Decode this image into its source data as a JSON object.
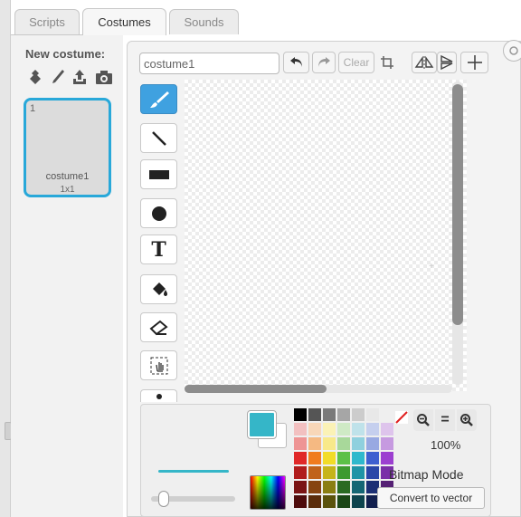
{
  "tabs": [
    {
      "label": "Scripts",
      "active": false
    },
    {
      "label": "Costumes",
      "active": true
    },
    {
      "label": "Sounds",
      "active": false
    }
  ],
  "sidebar": {
    "new_costume_label": "New costume:",
    "new_costume_icons": [
      "sprite-library-icon",
      "paint-brush-icon",
      "upload-icon",
      "camera-icon"
    ],
    "costume": {
      "index": "1",
      "name": "costume1",
      "size": "1x1"
    }
  },
  "editor": {
    "costume_name_value": "costume1",
    "toolbar": {
      "undo_icon": "undo-icon",
      "redo_icon": "redo-icon",
      "clear_label": "Clear",
      "crop_icon": "crop-icon",
      "flip_h_icon": "flip-horizontal-icon",
      "flip_v_icon": "flip-vertical-icon",
      "center_icon": "set-center-icon"
    },
    "tools": [
      {
        "name": "brush",
        "selected": true
      },
      {
        "name": "line"
      },
      {
        "name": "rectangle"
      },
      {
        "name": "ellipse"
      },
      {
        "name": "text",
        "label": "T"
      },
      {
        "name": "fill"
      },
      {
        "name": "eraser"
      },
      {
        "name": "select"
      },
      {
        "name": "stamp"
      }
    ],
    "colors": {
      "primary": "#35b6c8",
      "secondary": "#ffffff",
      "selected_tool": "#3fa1e0"
    },
    "palette": [
      [
        "#000000",
        "#555555",
        "#7a7a7a",
        "#a6a6a6",
        "#cccccc",
        "#e8e8e8",
        "#ffffff"
      ],
      [
        "#f2c0c0",
        "#f8d7b8",
        "#fbf2b6",
        "#cfeac5",
        "#bfe2ea",
        "#c5cfee",
        "#dec4ec"
      ],
      [
        "#ee9494",
        "#f5b982",
        "#f8e98a",
        "#a8d89a",
        "#8fd0de",
        "#98a9e2",
        "#c69ae0"
      ],
      [
        "#e02828",
        "#f07c1e",
        "#f2dc28",
        "#5cc048",
        "#2fb8cc",
        "#3e5fd0",
        "#9c3fd0"
      ],
      [
        "#b01c1c",
        "#c0621a",
        "#c6b41a",
        "#3e9a30",
        "#1f94a6",
        "#2a46a8",
        "#7a2ea8"
      ],
      [
        "#7a1414",
        "#864410",
        "#8a7e12",
        "#2a6a22",
        "#156674",
        "#1c2f74",
        "#552074"
      ],
      [
        "#4e0c0c",
        "#5a2c0a",
        "#5a520c",
        "#1b4616",
        "#0e444e",
        "#121f4e",
        "#38154e"
      ]
    ],
    "zoom": {
      "out_icon": "zoom-out-icon",
      "reset_label": "=",
      "in_icon": "zoom-in-icon",
      "level": "100%"
    },
    "mode_label": "Bitmap Mode",
    "convert_button_label": "Convert to vector"
  }
}
